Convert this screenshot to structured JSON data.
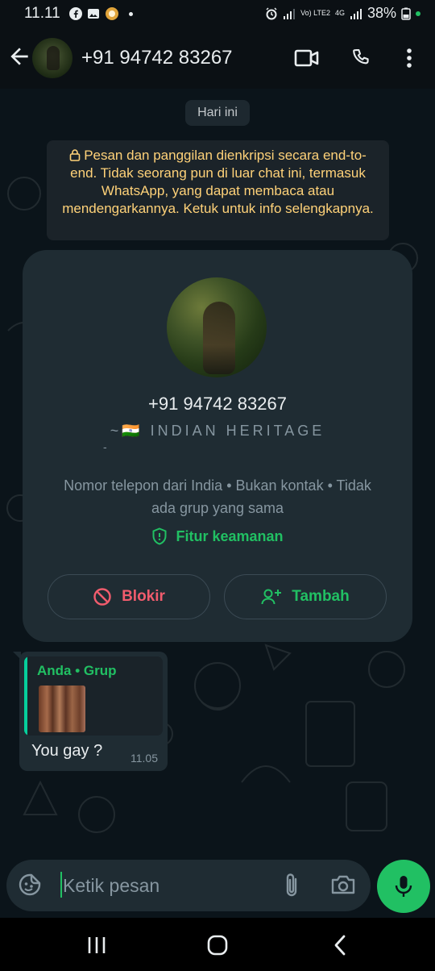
{
  "status": {
    "time": "11.11",
    "battery": "38%",
    "net1": "Vo) LTE2",
    "net2": "4G"
  },
  "header": {
    "title": "+91 94742 83267"
  },
  "chat": {
    "date_label": "Hari ini",
    "encryption_notice": "Pesan dan panggilan dienkripsi secara end-to-end. Tidak seorang pun di luar chat ini, termasuk WhatsApp, yang dapat membaca atau mendengarkannya. Ketuk untuk info selengkapnya."
  },
  "contact_card": {
    "phone": "+91 94742 83267",
    "about": "~🇮🇳 INDIAN HERITAGE",
    "about_dash": "-",
    "info_line": "Nomor telepon dari India • Bukan kontak • Tidak ada grup yang sama",
    "security_label": "Fitur keamanan",
    "block_label": "Blokir",
    "add_label": "Tambah"
  },
  "message": {
    "quote_title": "Anda • Grup",
    "text": "You gay ?",
    "time": "11.05"
  },
  "composer": {
    "placeholder": "Ketik pesan"
  },
  "colors": {
    "accent": "#21c063",
    "danger": "#f15c6d",
    "notice": "#ffd279",
    "bubble": "#1f2c33"
  },
  "icons": [
    "back-arrow-icon",
    "video-call-icon",
    "phone-icon",
    "more-vert-icon",
    "lock-icon",
    "shield-icon",
    "block-icon",
    "add-person-icon",
    "sticker-icon",
    "attach-icon",
    "camera-icon",
    "mic-icon"
  ]
}
